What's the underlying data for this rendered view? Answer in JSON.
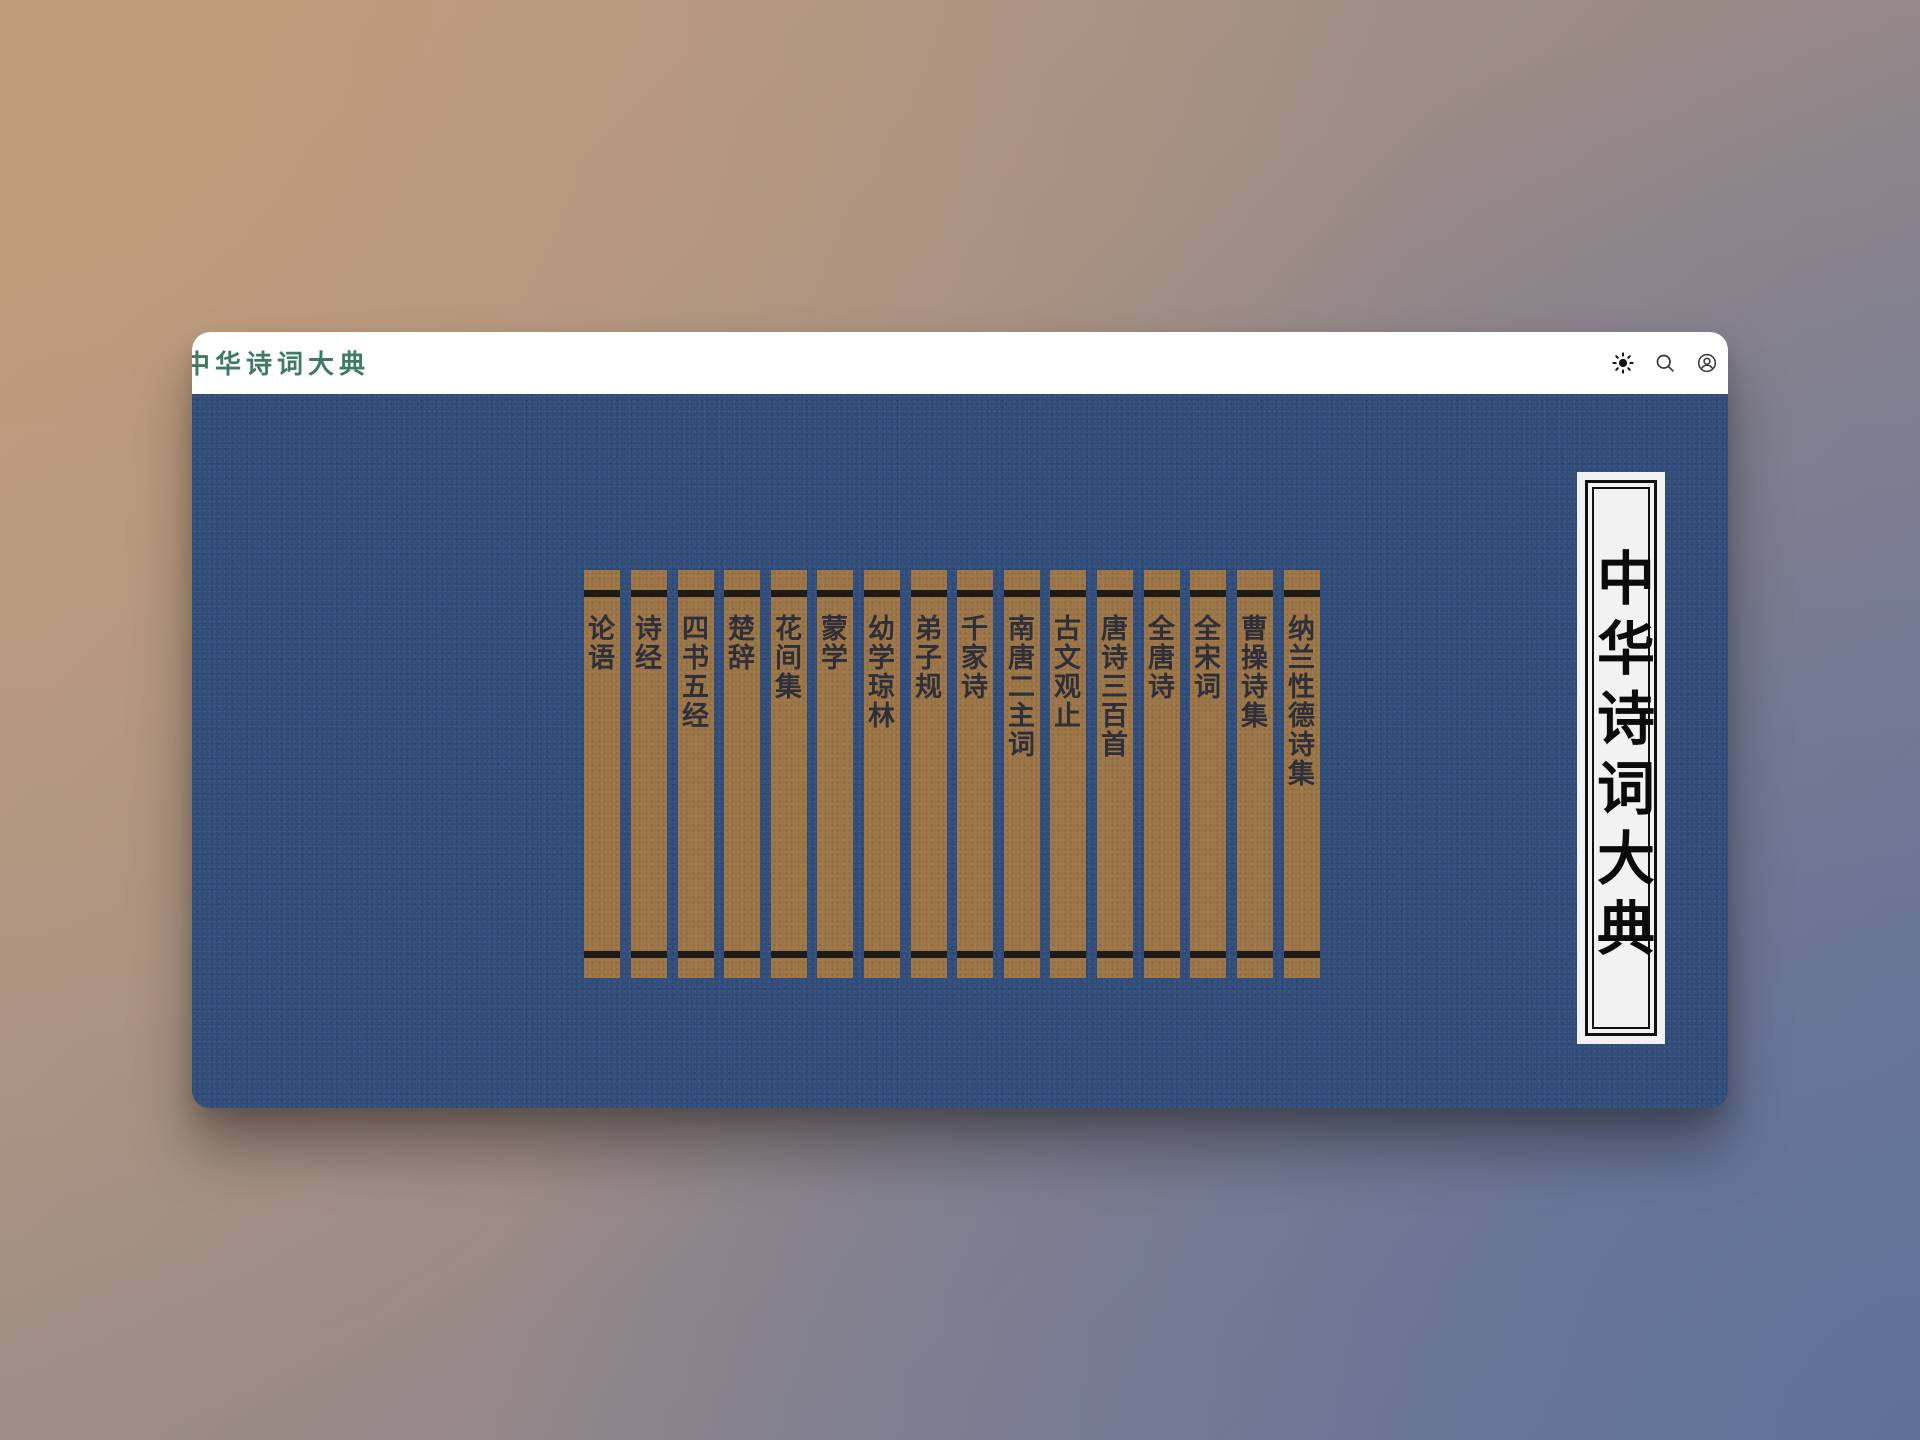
{
  "app": {
    "brand": "中华诗词大典"
  },
  "toolbar": {
    "theme_icon": "sun-icon",
    "search_icon": "search-icon",
    "account_icon": "user-circle-icon"
  },
  "hero": {
    "title_slip": "中华诗词大典"
  },
  "books": [
    {
      "title": "论语"
    },
    {
      "title": "诗经"
    },
    {
      "title": "四书五经"
    },
    {
      "title": "楚辞"
    },
    {
      "title": "花间集"
    },
    {
      "title": "蒙学"
    },
    {
      "title": "幼学琼林"
    },
    {
      "title": "弟子规"
    },
    {
      "title": "千家诗"
    },
    {
      "title": "南唐二主词"
    },
    {
      "title": "古文观止"
    },
    {
      "title": "唐诗三百首"
    },
    {
      "title": "全唐诗"
    },
    {
      "title": "全宋词"
    },
    {
      "title": "曹操诗集"
    },
    {
      "title": "纳兰性德诗集"
    }
  ],
  "colors": {
    "brand": "#3f7a63",
    "cover_blue": "#2e4a78",
    "book_spine": "#9a7446",
    "book_text": "#2f2f3a",
    "band": "#1f1b17",
    "slip_paper": "#f2f2f2"
  }
}
